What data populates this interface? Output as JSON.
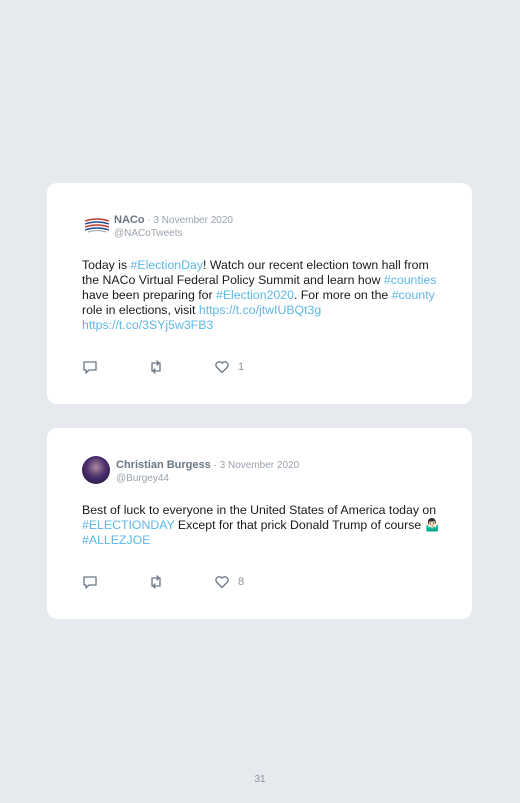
{
  "tweets": [
    {
      "name": "NACo",
      "sep": " · ",
      "date": "3 November 2020",
      "handle": "@NACoTweets",
      "text_parts": {
        "p1": "Today is ",
        "h1": "#ElectionDay",
        "p2": "! Watch our recent election town hall from the NACo Virtual Federal Policy Summit and learn how ",
        "h2": "#counties",
        "p3": " have been preparing for ",
        "h3": "#Election2020",
        "p4": ". For more on the ",
        "h4": "#county",
        "p5": " role in elections, visit ",
        "l1": "https://t.co/jtwIUBQt3g",
        "p6": " ",
        "l2": "https://t.co/3SYj5w3FB3"
      },
      "likes": "1"
    },
    {
      "name": "Christian Burgess",
      "sep": " · ",
      "date": "3 November 2020",
      "handle": "@Burgey44",
      "text_parts": {
        "p1": "Best of luck to everyone in the United States of America today on ",
        "h1": "#ELECTIONDAY",
        "p2": " Except for that prick Donald Trump of course 🤷🏻‍♂️ ",
        "h2": "#ALLEZJOE"
      },
      "likes": "8"
    }
  ],
  "icons": {
    "reply": "reply-icon",
    "retweet": "retweet-icon",
    "like": "heart-icon"
  },
  "colors": {
    "link": "#5cb7e6",
    "background": "#e6eaef"
  },
  "page_number": "31"
}
